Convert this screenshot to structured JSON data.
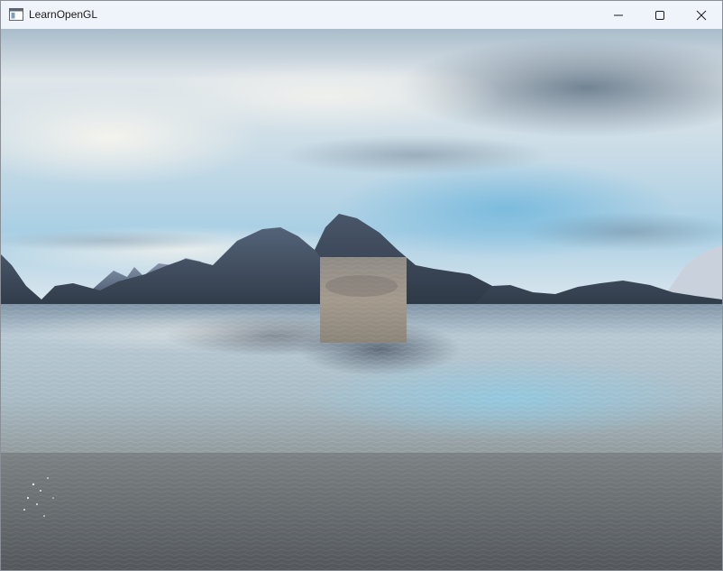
{
  "window": {
    "title": "LearnOpenGL",
    "controls": {
      "minimize_icon": "minimize-icon",
      "maximize_icon": "maximize-icon",
      "close_icon": "close-icon"
    }
  },
  "scene": {
    "description_icons": [
      "skybox",
      "mountains",
      "water",
      "textured-quad"
    ],
    "colors": {
      "sky_top": "#9fb6c8",
      "sky_cloud": "#e9eef2",
      "sky_blue": "#8fc3df",
      "mountain": "#4c5a6c",
      "water_near": "#6f7578",
      "water_far": "#a7b8c4",
      "quad": "#9c958b"
    }
  }
}
